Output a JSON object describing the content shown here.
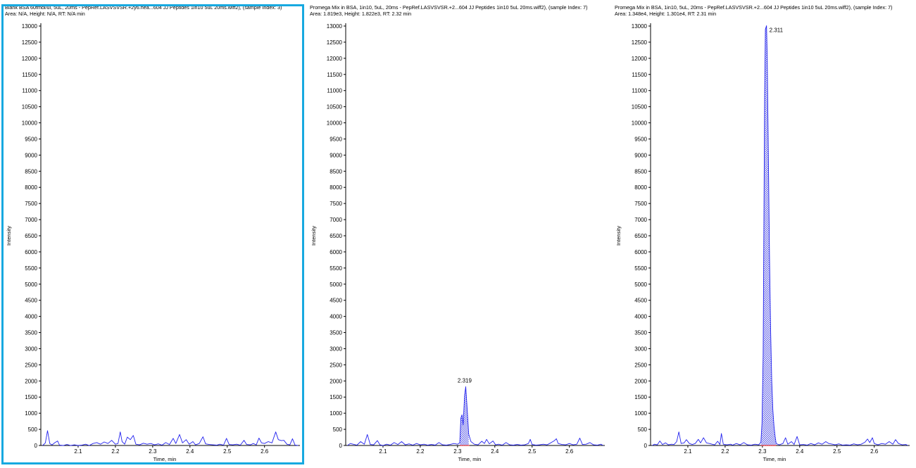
{
  "colors": {
    "trace": "#2222ee",
    "fill": "#6b6be8",
    "baseline": "#e03030",
    "selection": "#17a9e0",
    "axis": "#000000"
  },
  "chart_data": [
    {
      "type": "line",
      "title": "Blank BSA 60fmol/ul, 5uL, 20ms - PepRef.LASVSVSR.+2y6.hea...604 JJ Peptides 1in10 5uL 20ms.wiff2), (sample Index: 3)",
      "subtitle": "Area: N/A, Height: N/A, RT: N/A min",
      "xlabel": "Time, min",
      "ylabel": "Intensity",
      "xlim": [
        2.0,
        2.695
      ],
      "ylim": [
        0,
        13000
      ],
      "xticks": [
        2.1,
        2.2,
        2.3,
        2.4,
        2.5,
        2.6
      ],
      "yticks": [
        0,
        500,
        1000,
        1500,
        2000,
        2500,
        3000,
        3500,
        4000,
        4500,
        5000,
        5500,
        6000,
        6500,
        7000,
        7500,
        8000,
        8500,
        9000,
        9500,
        10000,
        10500,
        11000,
        11500,
        12000,
        12500,
        13000
      ],
      "selected": true,
      "peak": null,
      "points": [
        [
          2.005,
          0
        ],
        [
          2.012,
          80
        ],
        [
          2.018,
          460
        ],
        [
          2.024,
          60
        ],
        [
          2.03,
          20
        ],
        [
          2.038,
          90
        ],
        [
          2.045,
          140
        ],
        [
          2.05,
          10
        ],
        [
          2.06,
          0
        ],
        [
          2.07,
          30
        ],
        [
          2.08,
          0
        ],
        [
          2.09,
          20
        ],
        [
          2.1,
          0
        ],
        [
          2.11,
          10
        ],
        [
          2.12,
          40
        ],
        [
          2.13,
          0
        ],
        [
          2.14,
          60
        ],
        [
          2.15,
          90
        ],
        [
          2.16,
          40
        ],
        [
          2.17,
          110
        ],
        [
          2.18,
          60
        ],
        [
          2.19,
          160
        ],
        [
          2.2,
          40
        ],
        [
          2.207,
          60
        ],
        [
          2.213,
          420
        ],
        [
          2.218,
          120
        ],
        [
          2.225,
          40
        ],
        [
          2.232,
          260
        ],
        [
          2.24,
          180
        ],
        [
          2.248,
          310
        ],
        [
          2.255,
          40
        ],
        [
          2.265,
          20
        ],
        [
          2.275,
          70
        ],
        [
          2.285,
          40
        ],
        [
          2.295,
          60
        ],
        [
          2.305,
          20
        ],
        [
          2.315,
          50
        ],
        [
          2.325,
          10
        ],
        [
          2.335,
          90
        ],
        [
          2.345,
          30
        ],
        [
          2.355,
          220
        ],
        [
          2.362,
          60
        ],
        [
          2.372,
          340
        ],
        [
          2.38,
          80
        ],
        [
          2.39,
          180
        ],
        [
          2.398,
          40
        ],
        [
          2.408,
          120
        ],
        [
          2.415,
          20
        ],
        [
          2.425,
          60
        ],
        [
          2.435,
          270
        ],
        [
          2.442,
          50
        ],
        [
          2.452,
          30
        ],
        [
          2.462,
          20
        ],
        [
          2.472,
          10
        ],
        [
          2.48,
          40
        ],
        [
          2.49,
          10
        ],
        [
          2.498,
          220
        ],
        [
          2.505,
          30
        ],
        [
          2.515,
          20
        ],
        [
          2.525,
          40
        ],
        [
          2.535,
          10
        ],
        [
          2.545,
          160
        ],
        [
          2.552,
          30
        ],
        [
          2.562,
          20
        ],
        [
          2.57,
          60
        ],
        [
          2.578,
          20
        ],
        [
          2.585,
          230
        ],
        [
          2.592,
          80
        ],
        [
          2.6,
          60
        ],
        [
          2.61,
          120
        ],
        [
          2.62,
          80
        ],
        [
          2.63,
          420
        ],
        [
          2.637,
          180
        ],
        [
          2.645,
          150
        ],
        [
          2.652,
          160
        ],
        [
          2.66,
          40
        ],
        [
          2.668,
          20
        ],
        [
          2.675,
          210
        ],
        [
          2.682,
          10
        ],
        [
          2.69,
          0
        ]
      ]
    },
    {
      "type": "line",
      "title": "Promega Mix in BSA, 1in10, 5uL, 20ms - PepRef.LASVSVSR.+2...604 JJ Peptides 1in10 5uL 20ms.wiff2), (sample Index: 7)",
      "subtitle": "Area: 1.819e3, Height: 1.822e3, RT: 2.32 min",
      "xlabel": "Time, min",
      "ylabel": "Intensity",
      "xlim": [
        2.0,
        2.695
      ],
      "ylim": [
        0,
        13000
      ],
      "xticks": [
        2.1,
        2.2,
        2.3,
        2.4,
        2.5,
        2.6
      ],
      "yticks": [
        0,
        500,
        1000,
        1500,
        2000,
        2500,
        3000,
        3500,
        4000,
        4500,
        5000,
        5500,
        6000,
        6500,
        7000,
        7500,
        8000,
        8500,
        9000,
        9500,
        10000,
        10500,
        11000,
        11500,
        12000,
        12500,
        13000
      ],
      "selected": false,
      "peak": {
        "label": "2.319",
        "rt": 2.319,
        "height": 1822,
        "range": [
          2.306,
          2.332
        ]
      },
      "points": [
        [
          2.005,
          0
        ],
        [
          2.012,
          60
        ],
        [
          2.02,
          40
        ],
        [
          2.03,
          10
        ],
        [
          2.04,
          120
        ],
        [
          2.05,
          40
        ],
        [
          2.058,
          340
        ],
        [
          2.066,
          30
        ],
        [
          2.075,
          20
        ],
        [
          2.085,
          150
        ],
        [
          2.092,
          20
        ],
        [
          2.1,
          0
        ],
        [
          2.11,
          40
        ],
        [
          2.12,
          10
        ],
        [
          2.13,
          90
        ],
        [
          2.14,
          30
        ],
        [
          2.15,
          120
        ],
        [
          2.16,
          20
        ],
        [
          2.17,
          50
        ],
        [
          2.18,
          10
        ],
        [
          2.19,
          60
        ],
        [
          2.2,
          20
        ],
        [
          2.21,
          40
        ],
        [
          2.22,
          10
        ],
        [
          2.23,
          30
        ],
        [
          2.24,
          10
        ],
        [
          2.25,
          90
        ],
        [
          2.26,
          20
        ],
        [
          2.27,
          10
        ],
        [
          2.28,
          30
        ],
        [
          2.29,
          60
        ],
        [
          2.3,
          40
        ],
        [
          2.306,
          80
        ],
        [
          2.309,
          850
        ],
        [
          2.312,
          950
        ],
        [
          2.315,
          640
        ],
        [
          2.319,
          1560
        ],
        [
          2.322,
          1822
        ],
        [
          2.326,
          1100
        ],
        [
          2.33,
          350
        ],
        [
          2.336,
          120
        ],
        [
          2.345,
          40
        ],
        [
          2.355,
          20
        ],
        [
          2.365,
          130
        ],
        [
          2.372,
          60
        ],
        [
          2.378,
          190
        ],
        [
          2.385,
          50
        ],
        [
          2.395,
          140
        ],
        [
          2.402,
          20
        ],
        [
          2.41,
          40
        ],
        [
          2.42,
          10
        ],
        [
          2.43,
          90
        ],
        [
          2.44,
          20
        ],
        [
          2.45,
          10
        ],
        [
          2.46,
          30
        ],
        [
          2.47,
          10
        ],
        [
          2.48,
          20
        ],
        [
          2.49,
          60
        ],
        [
          2.495,
          190
        ],
        [
          2.5,
          30
        ],
        [
          2.51,
          10
        ],
        [
          2.52,
          20
        ],
        [
          2.53,
          40
        ],
        [
          2.54,
          20
        ],
        [
          2.55,
          80
        ],
        [
          2.56,
          150
        ],
        [
          2.565,
          210
        ],
        [
          2.57,
          60
        ],
        [
          2.58,
          30
        ],
        [
          2.59,
          20
        ],
        [
          2.6,
          60
        ],
        [
          2.61,
          20
        ],
        [
          2.62,
          40
        ],
        [
          2.628,
          230
        ],
        [
          2.635,
          30
        ],
        [
          2.645,
          40
        ],
        [
          2.655,
          90
        ],
        [
          2.665,
          20
        ],
        [
          2.675,
          10
        ],
        [
          2.685,
          40
        ],
        [
          2.69,
          0
        ]
      ]
    },
    {
      "type": "line",
      "title": "Promega Mix in BSA, 1in10, 5uL, 20ms - PepRef.LASVSVSR.+2...604 JJ Peptides 1in10 5uL 20ms.wiff2), (sample Index: 7)",
      "subtitle": "Area: 1.348e4, Height: 1.301e4, RT: 2.31 min",
      "xlabel": "Time, min",
      "ylabel": "Intensity",
      "xlim": [
        2.0,
        2.695
      ],
      "ylim": [
        0,
        13000
      ],
      "xticks": [
        2.1,
        2.2,
        2.3,
        2.4,
        2.5,
        2.6
      ],
      "yticks": [
        0,
        500,
        1000,
        1500,
        2000,
        2500,
        3000,
        3500,
        4000,
        4500,
        5000,
        5500,
        6000,
        6500,
        7000,
        7500,
        8000,
        8500,
        9000,
        9500,
        10000,
        10500,
        11000,
        11500,
        12000,
        12500,
        13000
      ],
      "selected": false,
      "peak": {
        "label": "2.311",
        "rt": 2.311,
        "height": 13010,
        "range": [
          2.296,
          2.337
        ]
      },
      "points": [
        [
          2.005,
          0
        ],
        [
          2.01,
          40
        ],
        [
          2.018,
          20
        ],
        [
          2.025,
          140
        ],
        [
          2.032,
          30
        ],
        [
          2.04,
          80
        ],
        [
          2.048,
          20
        ],
        [
          2.056,
          40
        ],
        [
          2.063,
          30
        ],
        [
          2.07,
          120
        ],
        [
          2.076,
          420
        ],
        [
          2.082,
          60
        ],
        [
          2.09,
          80
        ],
        [
          2.096,
          180
        ],
        [
          2.104,
          60
        ],
        [
          2.112,
          30
        ],
        [
          2.12,
          60
        ],
        [
          2.128,
          190
        ],
        [
          2.134,
          80
        ],
        [
          2.142,
          240
        ],
        [
          2.15,
          80
        ],
        [
          2.158,
          60
        ],
        [
          2.165,
          40
        ],
        [
          2.172,
          20
        ],
        [
          2.18,
          130
        ],
        [
          2.186,
          30
        ],
        [
          2.19,
          370
        ],
        [
          2.195,
          40
        ],
        [
          2.205,
          20
        ],
        [
          2.215,
          40
        ],
        [
          2.22,
          10
        ],
        [
          2.23,
          60
        ],
        [
          2.24,
          20
        ],
        [
          2.25,
          90
        ],
        [
          2.26,
          20
        ],
        [
          2.27,
          10
        ],
        [
          2.28,
          40
        ],
        [
          2.29,
          20
        ],
        [
          2.296,
          100
        ],
        [
          2.299,
          700
        ],
        [
          2.302,
          2800
        ],
        [
          2.304,
          7000
        ],
        [
          2.306,
          10800
        ],
        [
          2.308,
          12900
        ],
        [
          2.311,
          13010
        ],
        [
          2.313,
          12000
        ],
        [
          2.316,
          9000
        ],
        [
          2.319,
          5900
        ],
        [
          2.322,
          3600
        ],
        [
          2.325,
          2000
        ],
        [
          2.328,
          1100
        ],
        [
          2.331,
          600
        ],
        [
          2.334,
          280
        ],
        [
          2.337,
          60
        ],
        [
          2.345,
          20
        ],
        [
          2.355,
          60
        ],
        [
          2.362,
          240
        ],
        [
          2.368,
          40
        ],
        [
          2.378,
          120
        ],
        [
          2.385,
          30
        ],
        [
          2.393,
          280
        ],
        [
          2.4,
          20
        ],
        [
          2.41,
          30
        ],
        [
          2.42,
          10
        ],
        [
          2.43,
          60
        ],
        [
          2.44,
          20
        ],
        [
          2.45,
          80
        ],
        [
          2.46,
          40
        ],
        [
          2.47,
          120
        ],
        [
          2.478,
          60
        ],
        [
          2.488,
          40
        ],
        [
          2.495,
          20
        ],
        [
          2.505,
          50
        ],
        [
          2.515,
          10
        ],
        [
          2.525,
          20
        ],
        [
          2.535,
          10
        ],
        [
          2.545,
          50
        ],
        [
          2.555,
          20
        ],
        [
          2.565,
          40
        ],
        [
          2.575,
          100
        ],
        [
          2.582,
          200
        ],
        [
          2.588,
          90
        ],
        [
          2.595,
          240
        ],
        [
          2.6,
          60
        ],
        [
          2.61,
          20
        ],
        [
          2.62,
          60
        ],
        [
          2.63,
          40
        ],
        [
          2.64,
          120
        ],
        [
          2.65,
          40
        ],
        [
          2.657,
          180
        ],
        [
          2.665,
          60
        ],
        [
          2.675,
          20
        ],
        [
          2.685,
          30
        ],
        [
          2.69,
          0
        ]
      ]
    }
  ]
}
